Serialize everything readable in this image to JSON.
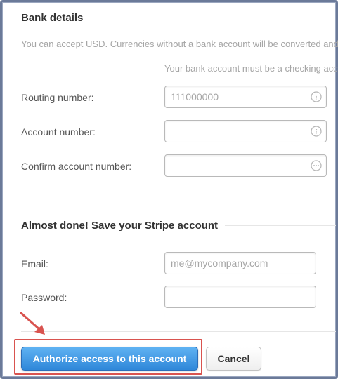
{
  "bank_details": {
    "title": "Bank details",
    "currency_hint": "You can accept USD. Currencies without a bank account will be converted and",
    "checking_hint": "Your bank account must be a checking acc",
    "routing_label": "Routing number:",
    "routing_placeholder": "111000000",
    "account_label": "Account number:",
    "account_value": "",
    "confirm_label": "Confirm account number:",
    "confirm_value": ""
  },
  "save_account": {
    "title": "Almost done! Save your Stripe account",
    "email_label": "Email:",
    "email_placeholder": "me@mycompany.com",
    "password_label": "Password:",
    "password_value": ""
  },
  "actions": {
    "authorize_label": "Authorize access to this account",
    "cancel_label": "Cancel"
  },
  "colors": {
    "primary_button": "#2f87d9",
    "highlight_border": "#d9534f",
    "annotation_arrow": "#d9534f"
  },
  "icons": {
    "routing_field": "info-icon",
    "account_field": "info-icon",
    "confirm_field": "ellipsis-icon",
    "annotation": "arrow-down-right"
  }
}
